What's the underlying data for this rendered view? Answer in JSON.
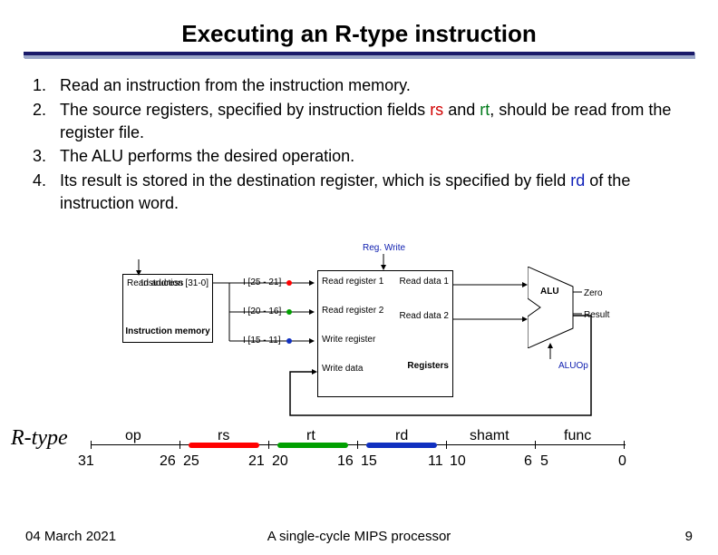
{
  "title": "Executing an R-type instruction",
  "steps": {
    "s1": "Read an instruction from the instruction memory.",
    "s2a": "The source registers, specified by instruction fields ",
    "s2_rs": "rs",
    "s2b": " and ",
    "s2_rt": "rt",
    "s2c": ", should be read from the register file.",
    "s3": "The ALU performs the desired operation.",
    "s4a": "Its result is stored in the destination register, which is specified by field ",
    "s4_rd": "rd",
    "s4b": " of the instruction word."
  },
  "diagram": {
    "regwrite": "Reg. Write",
    "read_addr": "Read\naddress",
    "instr_bits": "Instruction\n[31-0]",
    "instr_mem": "Instruction\nmemory",
    "i25_21": "I [25 - 21]",
    "i20_16": "I [20 - 16]",
    "i15_11": "I [15 - 11]",
    "read_reg1": "Read\nregister 1",
    "read_reg2": "Read\nregister 2",
    "write_reg": "Write\nregister",
    "write_data": "Write\ndata",
    "read_data1": "Read\ndata 1",
    "read_data2": "Read\ndata 2",
    "registers": "Registers",
    "alu": "ALU",
    "zero": "Zero",
    "result": "Result",
    "aluop": "ALUOp"
  },
  "fields": {
    "op": "op",
    "rs": "rs",
    "rt": "rt",
    "rd": "rd",
    "shamt": "shamt",
    "func": "func",
    "b31": "31",
    "b26": "26",
    "b25": "25",
    "b21": "21",
    "b20": "20",
    "b16": "16",
    "b15": "15",
    "b11": "11",
    "b10": "10",
    "b6": "6",
    "b5": "5",
    "b0": "0"
  },
  "handwritten": "R-type",
  "footer": {
    "date": "04 March 2021",
    "caption": "A single-cycle MIPS processor",
    "page": "9"
  }
}
